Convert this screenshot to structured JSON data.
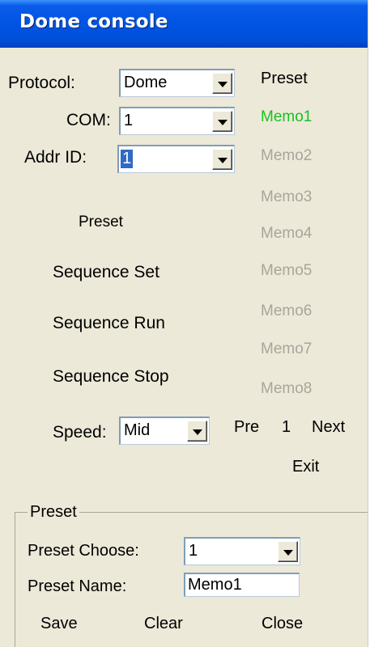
{
  "window": {
    "title": "Dome console"
  },
  "labels": {
    "protocol": "Protocol:",
    "com": "COM:",
    "addr_id": "Addr ID:",
    "preset_heading": "Preset",
    "speed": "Speed:"
  },
  "fields": {
    "protocol": "Dome",
    "com": "1",
    "addr_id": "1",
    "speed": "Mid"
  },
  "buttons": {
    "preset": "Preset",
    "sequence_set": "Sequence Set",
    "sequence_run": "Sequence Run",
    "sequence_stop": "Sequence Stop",
    "pre": "Pre",
    "page": "1",
    "next": "Next",
    "exit": "Exit"
  },
  "memos": [
    "Memo1",
    "Memo2",
    "Memo3",
    "Memo4",
    "Memo5",
    "Memo6",
    "Memo7",
    "Memo8"
  ],
  "preset_group": {
    "title": "Preset",
    "preset_choose_label": "Preset Choose:",
    "preset_choose_value": "1",
    "preset_name_label": "Preset Name:",
    "preset_name_value": "Memo1",
    "save": "Save",
    "clear": "Clear",
    "close": "Close"
  },
  "colors": {
    "title_bar": "#0054e3",
    "active_memo": "#16c21d",
    "disabled_text": "#a7a69c",
    "window_bg": "#ece9d8"
  }
}
